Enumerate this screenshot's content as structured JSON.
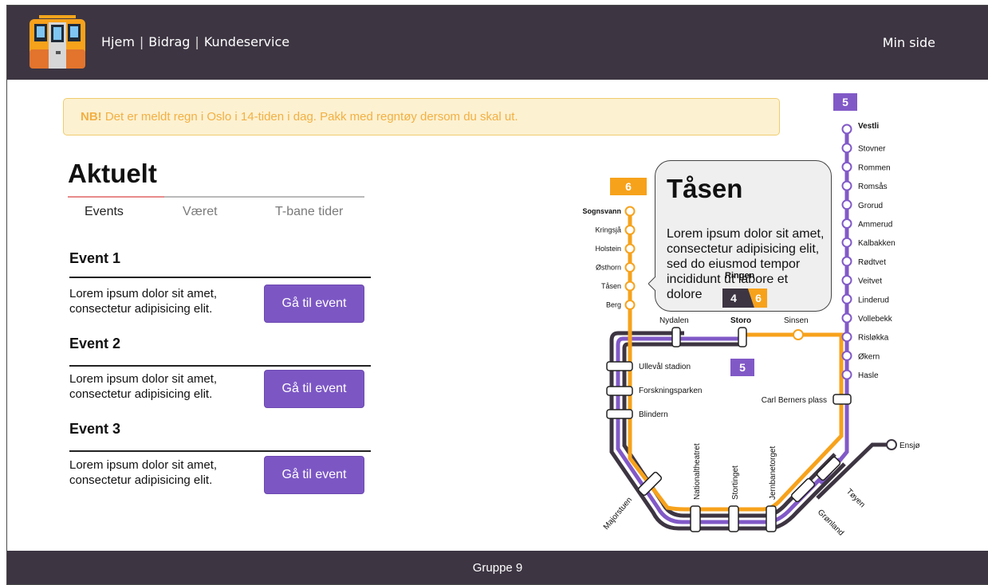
{
  "header": {
    "nav": [
      "Hjem",
      "Bidrag",
      "Kundeservice"
    ],
    "nav_sep": "|",
    "min_side": "Min side"
  },
  "alert": {
    "strong": "NB!",
    "text": " Det er meldt regn i Oslo i 14-tiden i dag. Pakk med regntøy dersom du skal ut."
  },
  "aktuelt": {
    "title": "Aktuelt",
    "tabs": [
      "Events",
      "Været",
      "T-bane tider"
    ],
    "events": [
      {
        "title": "Event 1",
        "desc": "Lorem ipsum dolor sit amet, consectetur adipisicing elit.",
        "button": "Gå til event"
      },
      {
        "title": "Event 2",
        "desc": "Lorem ipsum dolor sit amet, consectetur adipisicing elit.",
        "button": "Gå til event"
      },
      {
        "title": "Event 3",
        "desc": "Lorem ipsum dolor sit amet, consectetur adipisicing elit.",
        "button": "Gå til event"
      }
    ]
  },
  "map": {
    "line_numbers": {
      "line5_top": "5",
      "line6": "6",
      "line5_mid": "5",
      "badge4": "4",
      "badge6": "6"
    },
    "east_stations": [
      "Vestli",
      "Stovner",
      "Rommen",
      "Romsås",
      "Grorud",
      "Ammerud",
      "Kalbakken",
      "Rødtvet",
      "Veitvet",
      "Linderud",
      "Vollebekk",
      "Risløkka",
      "Økern",
      "Hasle"
    ],
    "west_stations": [
      "Sognsvann",
      "Kringsjå",
      "Holstein",
      "Østhorn",
      "Tåsen",
      "Berg"
    ],
    "top_stations": [
      "Nydalen",
      "Storo",
      "Sinsen"
    ],
    "ring_station": "Ringen",
    "inner_stations": [
      "Ullevål stadion",
      "Forskningsparken",
      "Blindern"
    ],
    "carl": "Carl Berners plass",
    "ensjo": "Ensjø",
    "bottom_stations": [
      "Majorstuen",
      "Nationaltheatret",
      "Stortinget",
      "Jernbanetorget",
      "Grønland",
      "Tøyen"
    ]
  },
  "popup": {
    "title": "Tåsen",
    "body": "Lorem ipsum dolor sit amet, consectetur adipisicing elit, sed do eiusmod tempor incididunt ut labore et dolore"
  },
  "footer": {
    "text": "Gruppe 9"
  },
  "colors": {
    "header_bg": "#3d3542",
    "accent_purple": "#7c57c4",
    "line_orange": "#f7a21b",
    "line_purple": "#8159c7",
    "alert_text": "#f2b043"
  }
}
